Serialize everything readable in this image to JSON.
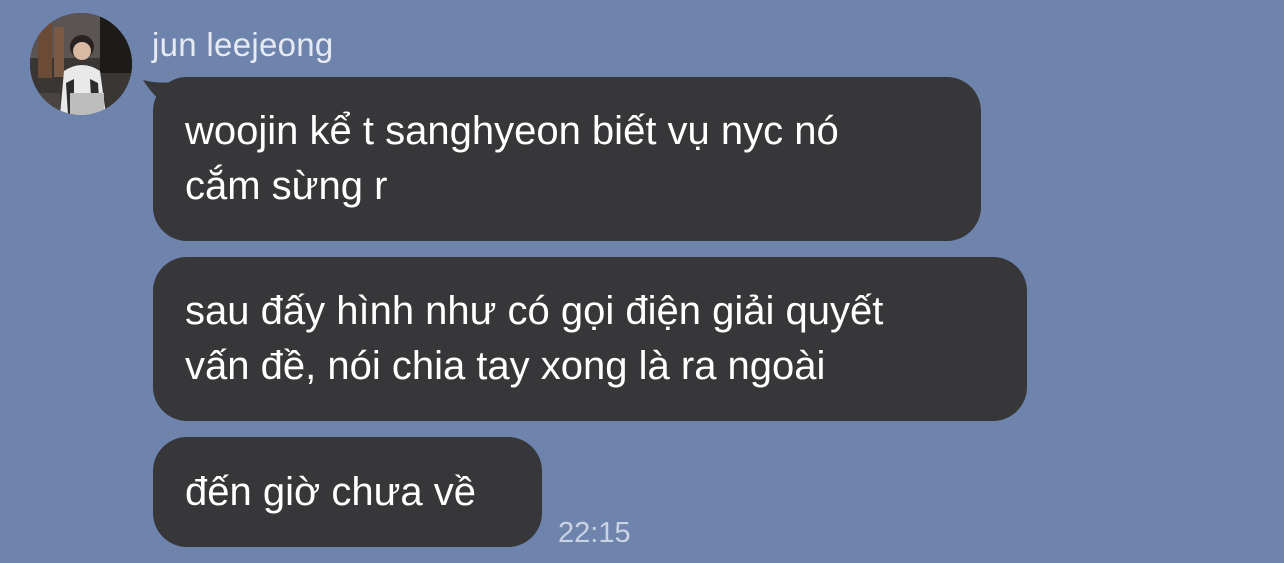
{
  "chat": {
    "sender_name": "jun leejeong",
    "messages": [
      {
        "lines": [
          "woojin kể t sanghyeon biết vụ nyc nó",
          "cắm sừng r"
        ]
      },
      {
        "lines": [
          "sau đấy hình như có gọi điện giải quyết",
          "vấn đề, nói chia tay xong là ra ngoài"
        ]
      },
      {
        "lines": [
          "đến giờ chưa về"
        ]
      }
    ],
    "timestamp": "22:15"
  },
  "colors": {
    "background": "#6e84ac",
    "bubble": "#373739",
    "bubble_text": "#ffffff",
    "sender_text": "#e6ebf3",
    "timestamp_text": "#c9d3e4"
  },
  "icons": {
    "avatar": "profile-photo"
  }
}
